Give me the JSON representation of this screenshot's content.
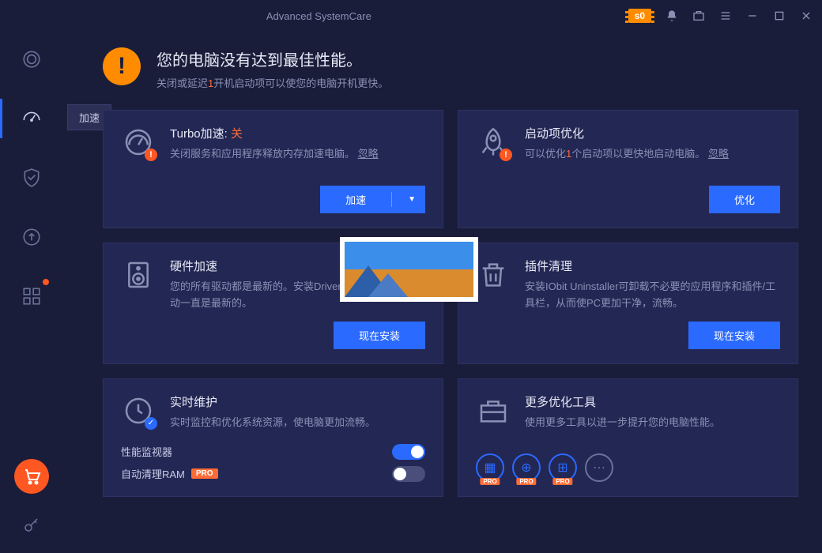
{
  "titlebar": {
    "title": "Advanced SystemCare",
    "badge": "s0"
  },
  "sidebar": {
    "tooltip": "加速"
  },
  "header": {
    "title": "您的电脑没有达到最佳性能。",
    "subtitle_pre": "关闭或延迟",
    "subtitle_count": "1",
    "subtitle_post": "开机启动项可以使您的电脑开机更快。"
  },
  "cards": {
    "turbo": {
      "title": "Turbo加速:",
      "status": "关",
      "desc": "关闭服务和应用程序释放内存加速电脑。",
      "ignore": "忽略",
      "btn": "加速"
    },
    "startup": {
      "title": "启动项优化",
      "desc_pre": "可以优化",
      "desc_count": "1",
      "desc_post": "个启动项以更快地启动电脑。",
      "ignore": "忽略",
      "btn": "优化"
    },
    "hardware": {
      "title": "硬件加速",
      "desc": "您的所有驱动都是最新的。安装Driver Booster 来保证驱动一直是最新的。",
      "btn": "现在安装"
    },
    "plugin": {
      "title": "插件清理",
      "desc": "安装IObit Uninstaller可卸载不必要的应用程序和插件/工具栏，从而使PC更加干净，流畅。",
      "btn": "现在安装"
    },
    "realtime": {
      "title": "实时维护",
      "desc": "实时监控和优化系统资源，使电脑更加流畅。",
      "monitor": "性能监视器",
      "autoram": "自动清理RAM",
      "pro": "PRO"
    },
    "moretools": {
      "title": "更多优化工具",
      "desc": "使用更多工具以进一步提升您的电脑性能。",
      "pro": "PRO"
    }
  }
}
